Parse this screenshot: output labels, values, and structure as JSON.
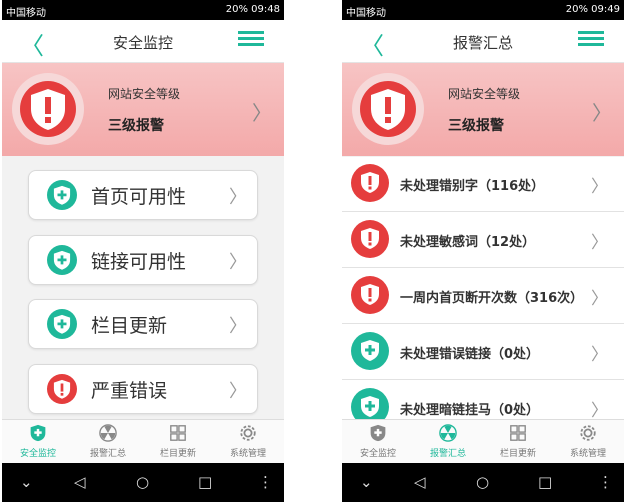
{
  "colors": {
    "accent": "#1fb89a",
    "alert": "#e53d3d",
    "header_bg": "#f3a9a9"
  },
  "left": {
    "status": {
      "carrier": "中国移动",
      "battery": "20%",
      "time": "09:48"
    },
    "nav": {
      "title": "安全监控"
    },
    "header": {
      "label": "网站安全等级",
      "level": "三级报警"
    },
    "menu": [
      {
        "label": "首页可用性",
        "icon": "plus-shield-icon",
        "color": "green"
      },
      {
        "label": "链接可用性",
        "icon": "plus-shield-icon",
        "color": "green"
      },
      {
        "label": "栏目更新",
        "icon": "plus-shield-icon",
        "color": "green"
      },
      {
        "label": "严重错误",
        "icon": "alert-shield-icon",
        "color": "red"
      }
    ]
  },
  "right": {
    "status": {
      "carrier": "中国移动",
      "battery": "20%",
      "time": "09:49"
    },
    "nav": {
      "title": "报警汇总"
    },
    "header": {
      "label": "网站安全等级",
      "level": "三级报警"
    },
    "alerts": [
      {
        "label": "未处理错别字（116处）",
        "icon": "alert-shield-icon",
        "color": "red"
      },
      {
        "label": "未处理敏感词（12处）",
        "icon": "alert-shield-icon",
        "color": "red"
      },
      {
        "label": "一周内首页断开次数（316次）",
        "icon": "alert-shield-icon",
        "color": "red"
      },
      {
        "label": "未处理错误链接（0处）",
        "icon": "plus-shield-icon",
        "color": "green"
      },
      {
        "label": "未处理暗链挂马（0处）",
        "icon": "plus-shield-icon",
        "color": "green"
      }
    ]
  },
  "tabs": [
    {
      "label": "安全监控",
      "icon": "shield-icon"
    },
    {
      "label": "报警汇总",
      "icon": "radiation-icon"
    },
    {
      "label": "栏目更新",
      "icon": "grid-icon"
    },
    {
      "label": "系统管理",
      "icon": "gear-icon"
    }
  ],
  "tab_active": {
    "left": 0,
    "right": 1
  },
  "glyphs": {
    "back": "〈",
    "chevron": "〉",
    "sys_down": "⌄",
    "sys_back": "◁",
    "sys_home": "○",
    "sys_recent": "□",
    "sys_more": "⋮"
  }
}
